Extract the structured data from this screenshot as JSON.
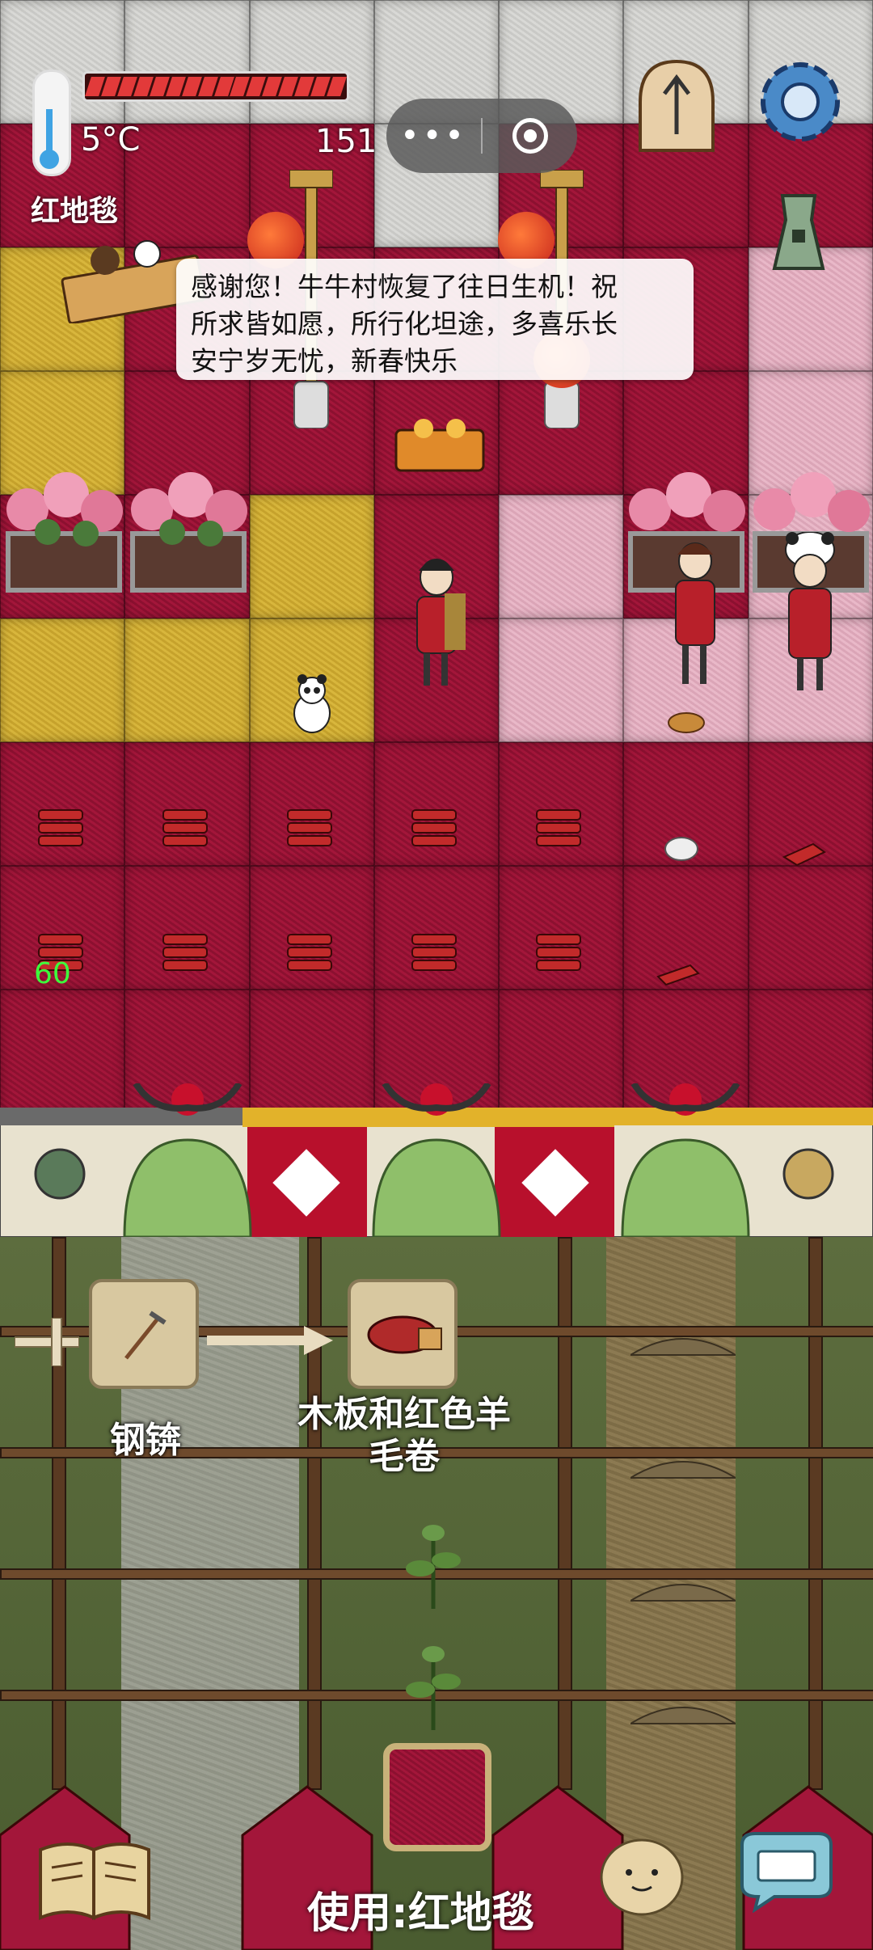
{
  "hud": {
    "temperature": "5°C",
    "health_fraction": 1.0,
    "counter": "151",
    "capsule_dots": "•••",
    "tile_name": "红地毯",
    "debug_number": "60"
  },
  "message": {
    "line1": "感谢您！牛牛村恢复了往日生机！祝",
    "line2": "所求皆如愿，所行化坦途，多喜乐长",
    "line3": "安宁岁无忧，新春快乐"
  },
  "recipe": {
    "tool_label": "钢锛",
    "result_line1": "木板和红色羊",
    "result_line2": "毛卷"
  },
  "action": {
    "use_label": "使用:红地毯"
  },
  "icons": {
    "thermometer": "thermometer-icon",
    "health": "health-bar",
    "clock": "clock-icon",
    "settings": "gear-icon",
    "coin": "ancient-coin-icon",
    "book": "recipe-book-icon",
    "chat": "keyboard-chat-icon",
    "emote": "bean-face-icon"
  },
  "colors": {
    "carpet_red": "#a3163a",
    "yellow_carpet": "#d8b63c",
    "pink_carpet": "#e9b8c8",
    "grass": "#4a5c30",
    "debug_green": "#3cff3c"
  }
}
